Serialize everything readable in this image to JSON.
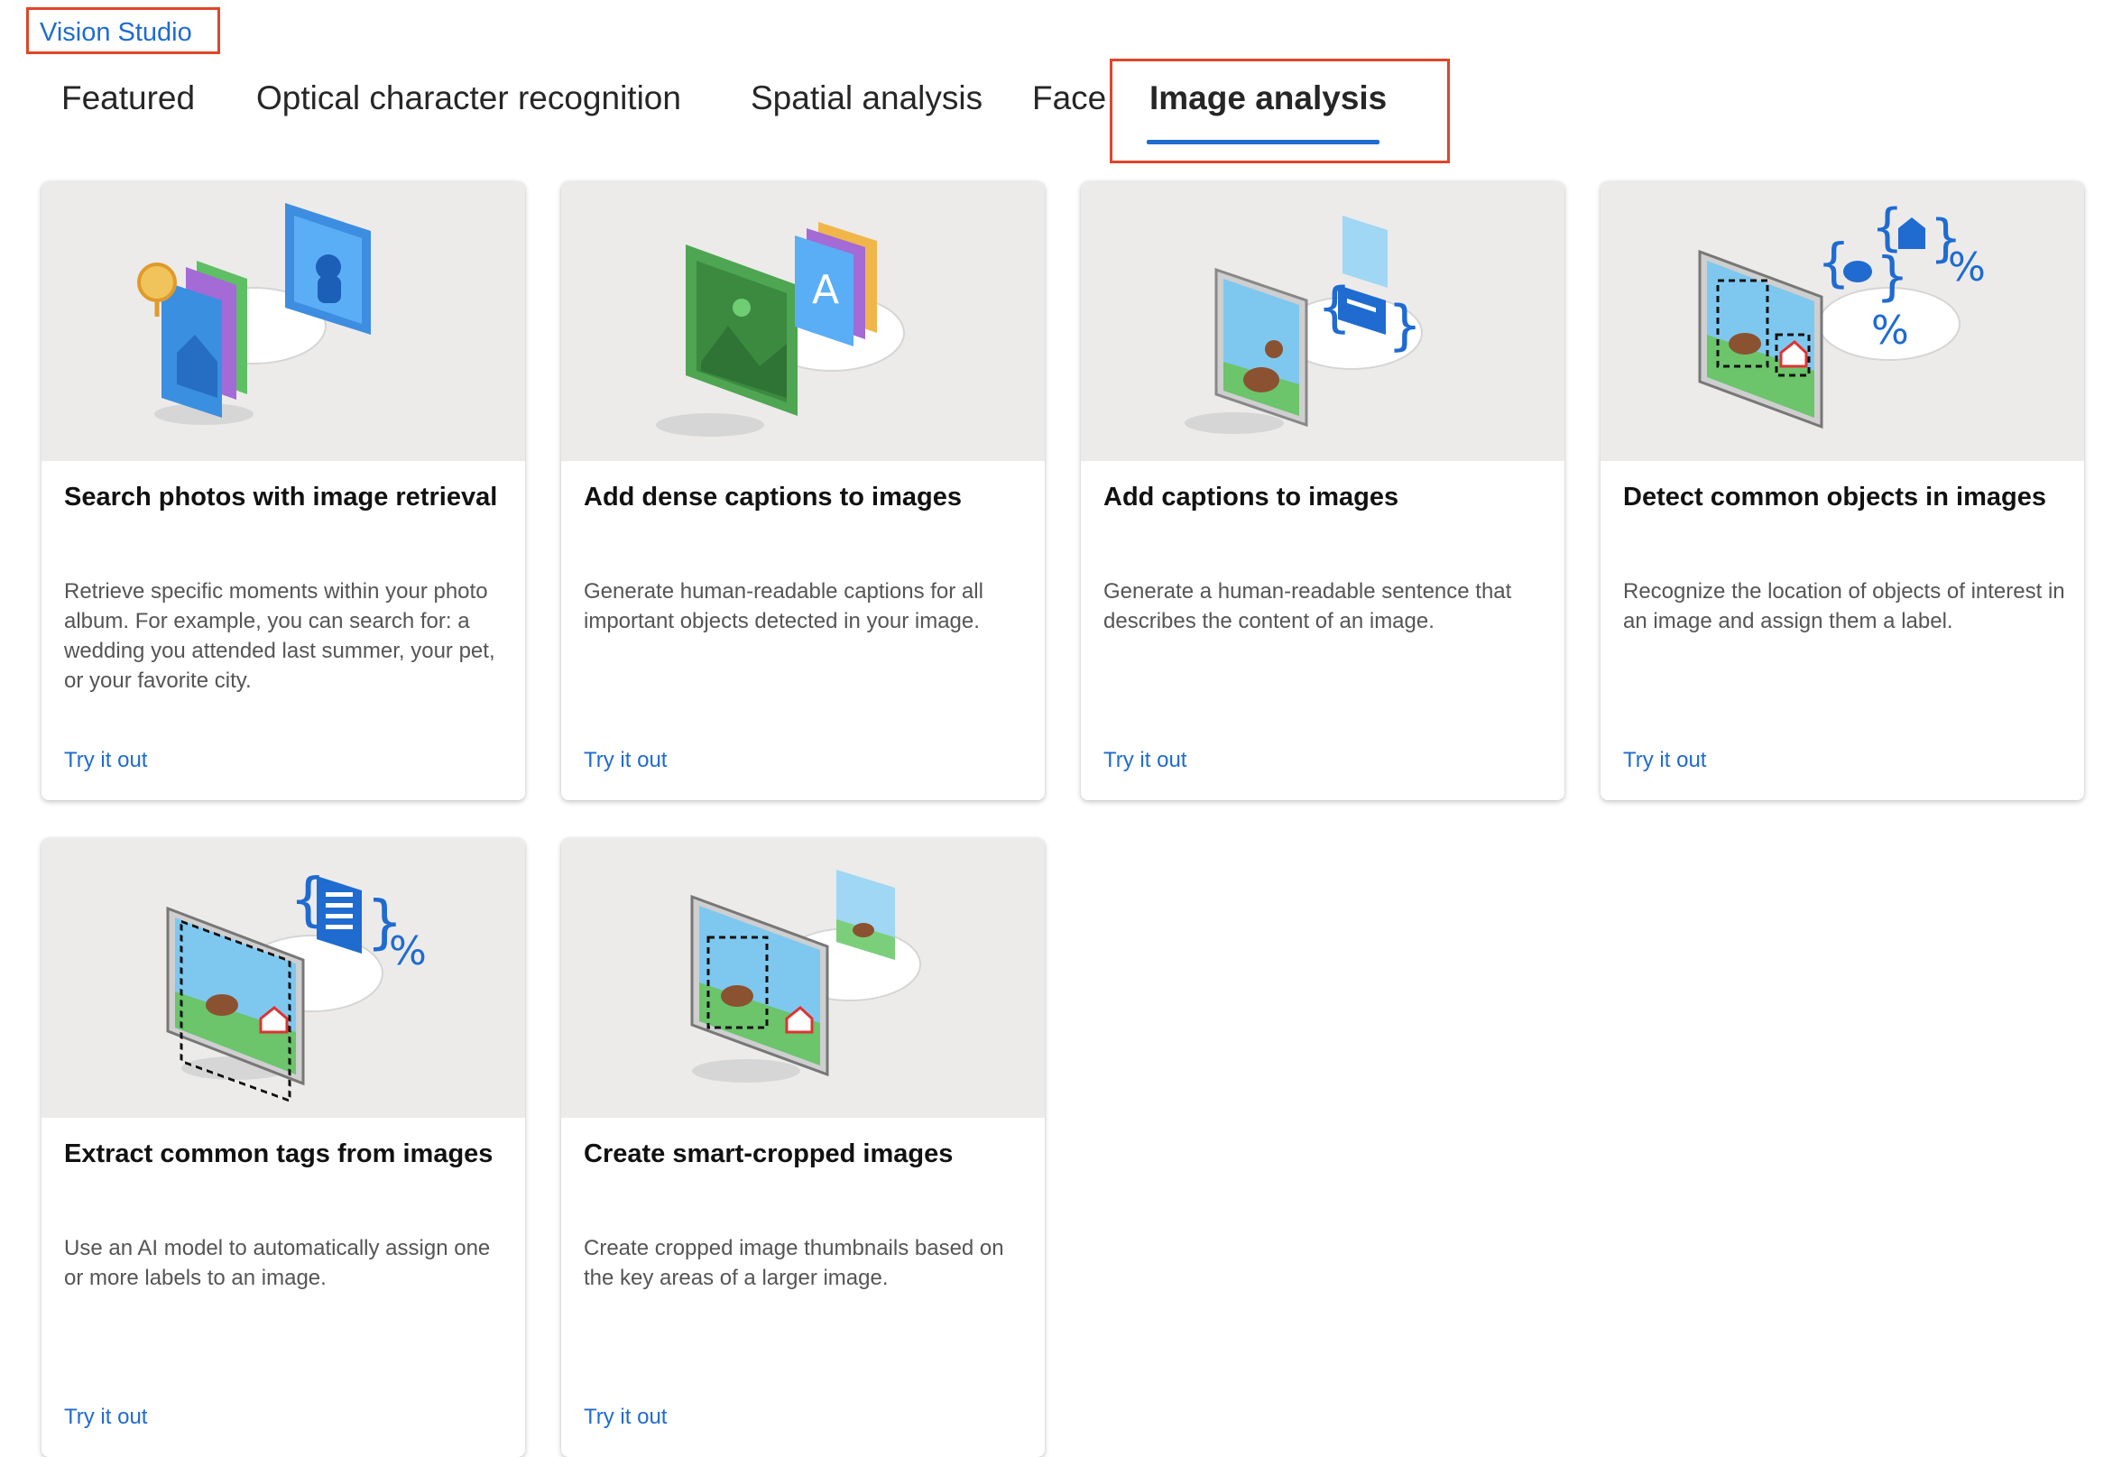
{
  "app": {
    "title": "Vision Studio"
  },
  "tabs": [
    {
      "label": "Featured"
    },
    {
      "label": "Optical character recognition"
    },
    {
      "label": "Spatial analysis"
    },
    {
      "label": "Face"
    },
    {
      "label": "Image analysis",
      "active": true
    }
  ],
  "cards": [
    {
      "title": "Search photos with image retrieval",
      "description": "Retrieve specific moments within your photo album. For example, you can search for: a wedding you attended last summer, your pet, or your favorite city.",
      "link": "Try it out",
      "icon": "image-retrieval-illustration"
    },
    {
      "title": "Add dense captions to images",
      "description": "Generate human-readable captions for all important objects detected in your image.",
      "link": "Try it out",
      "icon": "dense-captions-illustration"
    },
    {
      "title": "Add captions to images",
      "description": "Generate a human-readable sentence that describes the content of an image.",
      "link": "Try it out",
      "icon": "captions-illustration"
    },
    {
      "title": "Detect common objects in images",
      "description": "Recognize the location of objects of interest in an image and assign them a label.",
      "link": "Try it out",
      "icon": "object-detection-illustration"
    },
    {
      "title": "Extract common tags from images",
      "description": "Use an AI model to automatically assign one or more labels to an image.",
      "link": "Try it out",
      "icon": "tags-illustration"
    },
    {
      "title": "Create smart-cropped images",
      "description": "Create cropped image thumbnails based on the key areas of a larger image.",
      "link": "Try it out",
      "icon": "smart-crop-illustration"
    }
  ],
  "colors": {
    "accent": "#1f6bd0",
    "highlight_box": "#e0452a",
    "card_art_bg": "#ecebea"
  }
}
